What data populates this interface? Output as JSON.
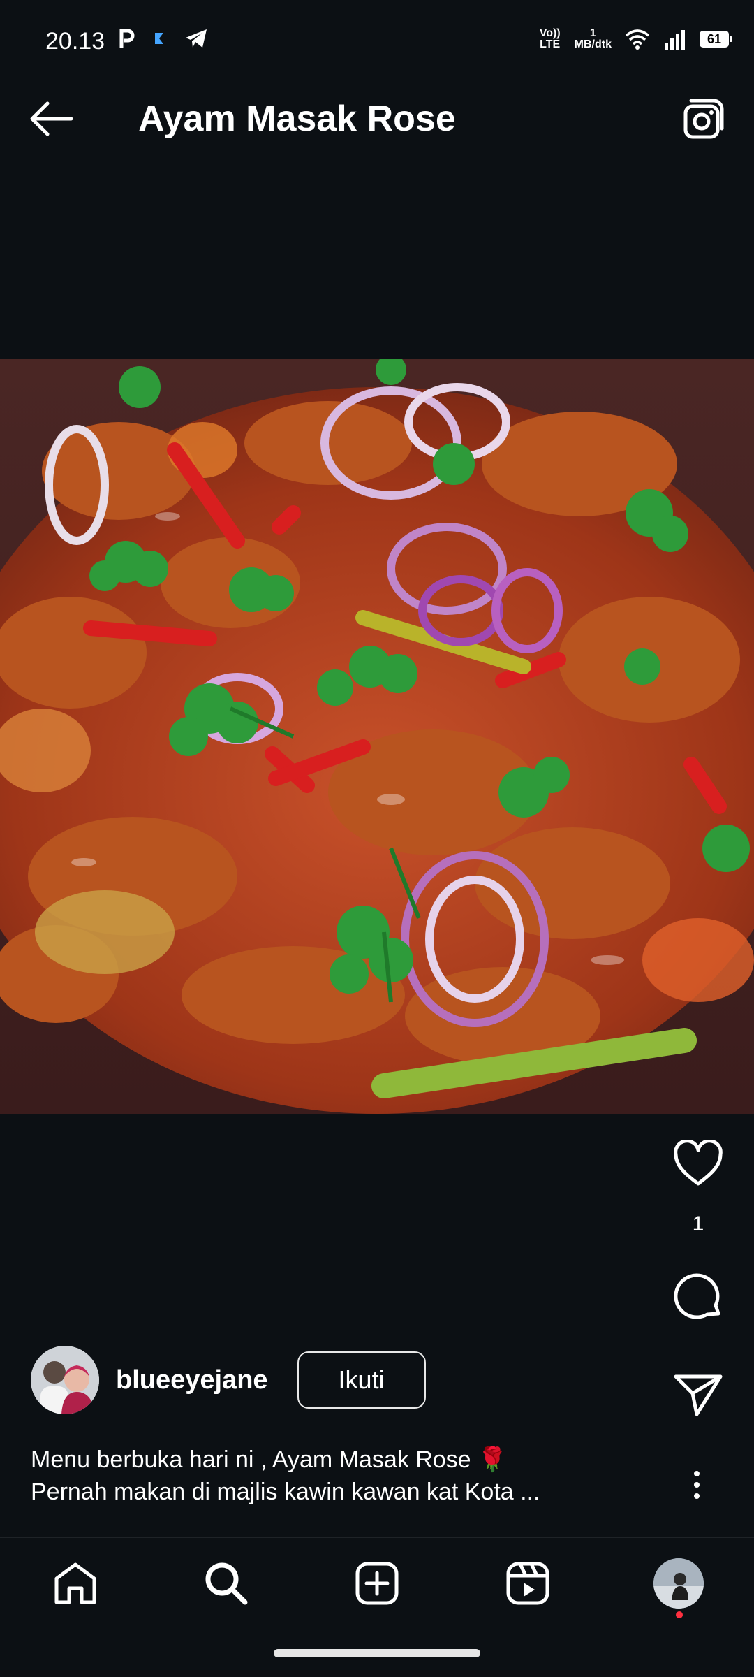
{
  "status_bar": {
    "time": "20.13",
    "volte": "Vo)) LTE",
    "speed_value": "1",
    "speed_unit": "MB/dtk",
    "battery": "61"
  },
  "header": {
    "title": "Ayam Masak Rose"
  },
  "post": {
    "like_count": "1",
    "author": {
      "username": "blueeyejane",
      "follow_label": "Ikuti"
    },
    "caption_line1": "Menu berbuka hari ni , Ayam Masak Rose 🌹",
    "caption_line2": "Pernah makan di majlis kawin kawan kat Kota ..."
  },
  "nav": {
    "items": [
      "home",
      "search",
      "create",
      "reels",
      "profile"
    ]
  },
  "colors": {
    "background": "#0c1014",
    "text": "#ffffff",
    "notification_dot": "#ff3040"
  }
}
